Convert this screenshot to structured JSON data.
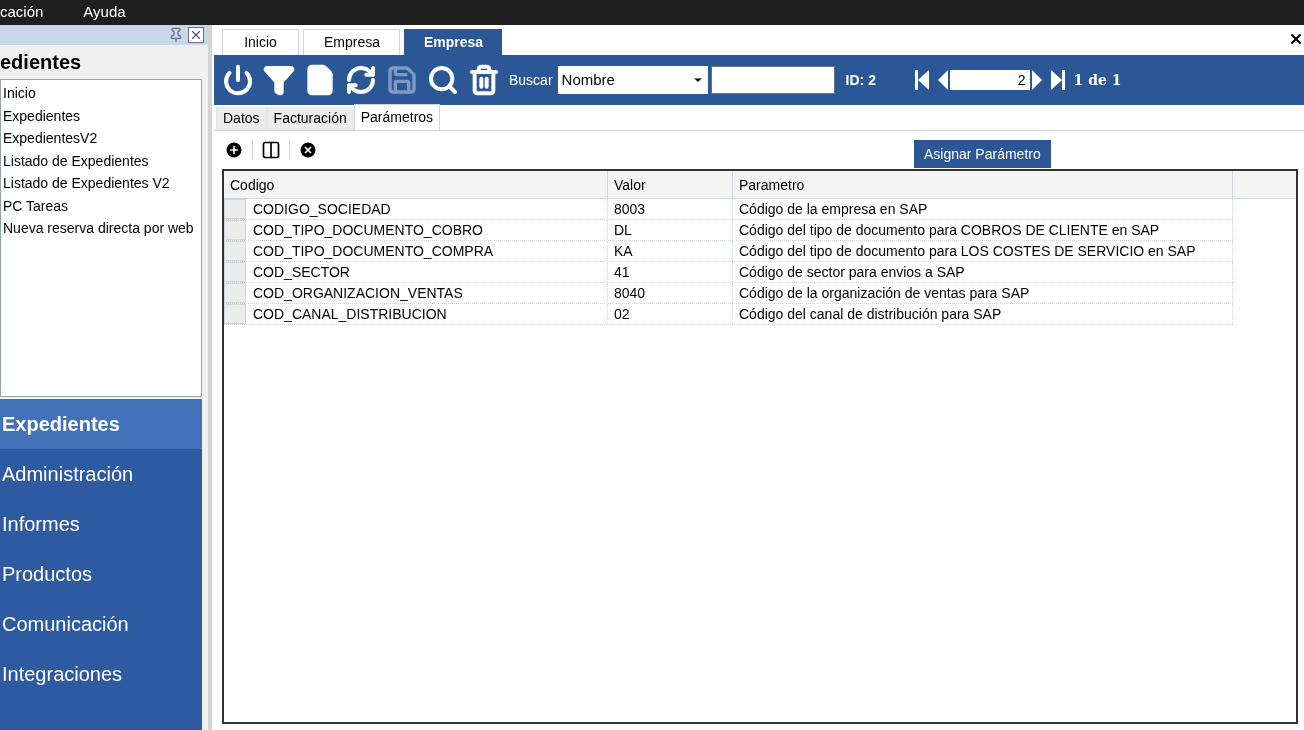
{
  "menu_bar": [
    "cación",
    "Ayuda"
  ],
  "side_panel": {
    "title": "edientes",
    "items": [
      "Inicio",
      "Expedientes",
      "ExpedientesV2",
      "Listado de Expedientes",
      "Listado de Expedientes V2",
      "PC Tareas",
      "Nueva reserva directa por web"
    ]
  },
  "nav_sections": [
    {
      "label": "Expedientes",
      "selected": true
    },
    {
      "label": "Administración",
      "selected": false
    },
    {
      "label": "Informes",
      "selected": false
    },
    {
      "label": "Productos",
      "selected": false
    },
    {
      "label": "Comunicación",
      "selected": false
    },
    {
      "label": "Integraciones",
      "selected": false
    }
  ],
  "doc_tabs": [
    {
      "label": "Inicio",
      "selected": false
    },
    {
      "label": "Empresa",
      "selected": false
    },
    {
      "label": "Empresa",
      "selected": true
    }
  ],
  "toolbar": {
    "search_label": "Buscar",
    "search_field": "Nombre",
    "id_label": "ID: 2",
    "page_value": "2",
    "page_count": "1 de 1",
    "save_disabled": true
  },
  "sub_tabs": [
    {
      "label": "Datos",
      "selected": false
    },
    {
      "label": "Facturación",
      "selected": false
    },
    {
      "label": "Parámetros",
      "selected": true
    }
  ],
  "assign_button": "Asignar Parámetro",
  "table": {
    "columns": [
      "Codigo",
      "Valor",
      "Parametro"
    ],
    "rows": [
      [
        "CODIGO_SOCIEDAD",
        "8003",
        "Código de la empresa en SAP"
      ],
      [
        "COD_TIPO_DOCUMENTO_COBRO",
        "DL",
        "Código del tipo de documento para COBROS DE CLIENTE en SAP"
      ],
      [
        "COD_TIPO_DOCUMENTO_COMPRA",
        "KA",
        "Código del tipo de documento para LOS COSTES DE SERVICIO en SAP"
      ],
      [
        "COD_SECTOR",
        "41",
        "Código de sector para envios a SAP"
      ],
      [
        "COD_ORGANIZACION_VENTAS",
        "8040",
        "Código de la organización de ventas para SAP"
      ],
      [
        "COD_CANAL_DISTRIBUCION",
        "02",
        "Código del canal de distribución para SAP"
      ]
    ]
  }
}
